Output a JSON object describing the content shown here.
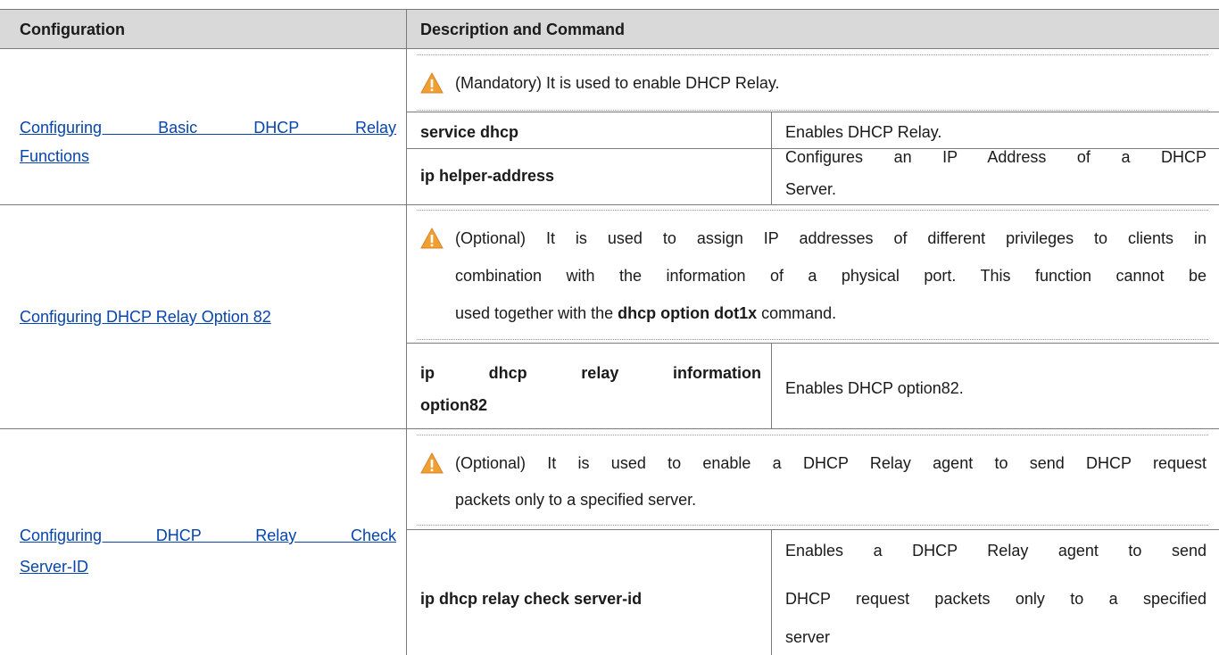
{
  "header": {
    "col1": "Configuration",
    "col2": "Description and Command"
  },
  "sections": [
    {
      "config_link": "Configuring Basic DHCP Relay Functions",
      "config_link_line1": "Configuring Basic DHCP Relay",
      "config_link_line2": "Functions",
      "note_icon": "warning-icon",
      "note": "(Mandatory) It is used to enable DHCP Relay.",
      "commands": [
        {
          "command": "service dhcp",
          "description": "Enables DHCP Relay."
        },
        {
          "command": "ip helper-address",
          "description_line1": "Configures an IP Address of a DHCP",
          "description_line2": "Server."
        }
      ]
    },
    {
      "config_link": "Configuring DHCP Relay Option 82",
      "note_icon": "warning-icon",
      "note_line1": "(Optional) It is used to assign IP addresses of different privileges to clients in",
      "note_line2": "combination with the information of a physical port. This function cannot be",
      "note_line3_pre": "used together with the",
      "note_line3_cmd": "dhcp option dot1x",
      "note_line3_post": "command.",
      "commands": [
        {
          "command_line1": "ip dhcp relay information",
          "command_line2": "option82",
          "description": "Enables DHCP option82."
        }
      ]
    },
    {
      "config_link_line1": "Configuring DHCP Relay Check",
      "config_link_line2": "Server-ID",
      "note_icon": "warning-icon",
      "note_line1": "(Optional) It is used to enable a DHCP Relay agent to send DHCP request",
      "note_line2": "packets only to a specified server.",
      "commands": [
        {
          "command": "ip dhcp relay check server-id",
          "description_line1": "Enables a DHCP Relay agent to send",
          "description_line2": "DHCP request packets only to a specified",
          "description_line3": "server"
        }
      ]
    }
  ],
  "colors": {
    "header_bg": "#d9d9d9",
    "link": "#0645ad",
    "warning": "#f0a030"
  }
}
